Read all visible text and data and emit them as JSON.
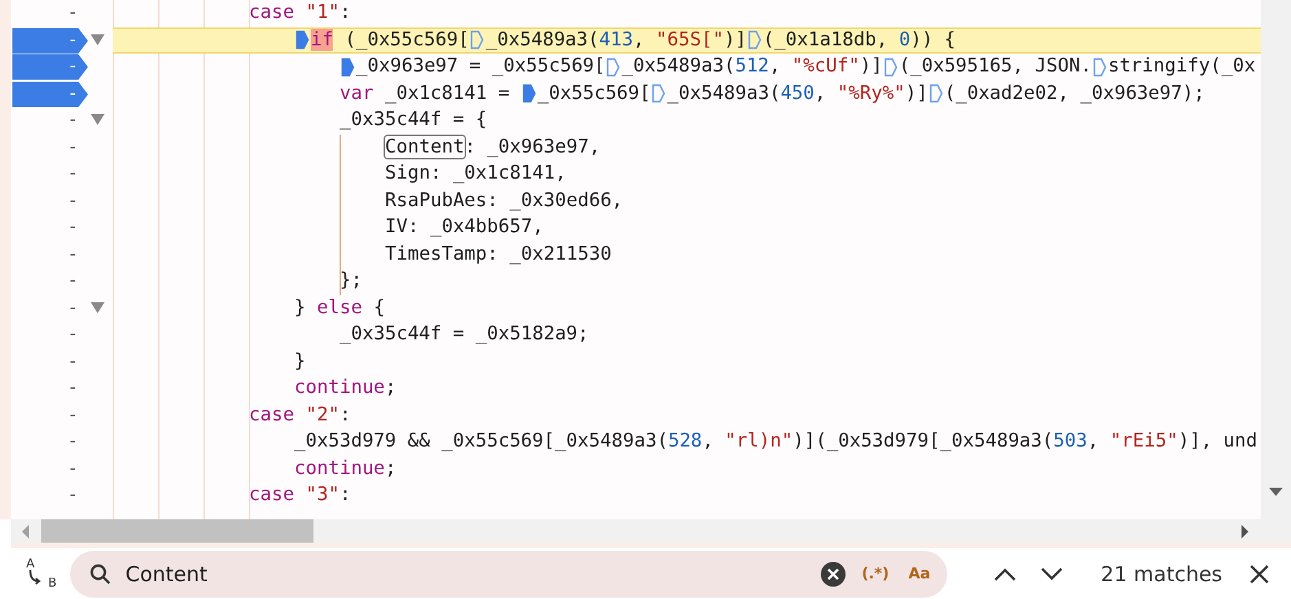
{
  "code_lines": [
    {
      "gutter": "-",
      "breakpoint": false,
      "fold_marker": false,
      "current": false,
      "tokens": [
        {
          "kind": "k",
          "text": "case"
        },
        {
          "kind": "s",
          "text": " \"1\""
        },
        {
          "kind": "t",
          "text": ":"
        }
      ],
      "children": [
        {
          "gutter": "-",
          "breakpoint": true,
          "fold_marker": true,
          "current": true,
          "tokens": [
            {
              "kind": "bp",
              "active": true
            },
            {
              "kind": "paused",
              "text": "if"
            },
            {
              "kind": "t",
              "text": " (_0x55c569["
            },
            {
              "kind": "bp",
              "active": false
            },
            {
              "kind": "t",
              "text": "_0x5489a3("
            },
            {
              "kind": "n",
              "text": "413"
            },
            {
              "kind": "t",
              "text": ", "
            },
            {
              "kind": "s",
              "text": "\"65S[\""
            },
            {
              "kind": "t",
              "text": ")]"
            },
            {
              "kind": "bp",
              "active": false
            },
            {
              "kind": "t",
              "text": "(_0x1a18db, "
            },
            {
              "kind": "n",
              "text": "0"
            },
            {
              "kind": "t",
              "text": ")) {"
            }
          ],
          "children": [
            {
              "gutter": "-",
              "breakpoint": true,
              "fold_marker": false,
              "current": false,
              "tokens": [
                {
                  "kind": "bp",
                  "active": true
                },
                {
                  "kind": "t",
                  "text": "_0x963e97 = _0x55c569["
                },
                {
                  "kind": "bp",
                  "active": false
                },
                {
                  "kind": "t",
                  "text": "_0x5489a3("
                },
                {
                  "kind": "n",
                  "text": "512"
                },
                {
                  "kind": "t",
                  "text": ", "
                },
                {
                  "kind": "s",
                  "text": "\"%cUf\""
                },
                {
                  "kind": "t",
                  "text": ")]"
                },
                {
                  "kind": "bp",
                  "active": false
                },
                {
                  "kind": "t",
                  "text": "(_0x595165, JSON."
                },
                {
                  "kind": "bp",
                  "active": false
                },
                {
                  "kind": "t",
                  "text": "stringify(_0x"
                }
              ]
            },
            {
              "gutter": "-",
              "breakpoint": true,
              "fold_marker": false,
              "current": false,
              "tokens": [
                {
                  "kind": "k",
                  "text": "var"
                },
                {
                  "kind": "t",
                  "text": " _0x1c8141 = "
                },
                {
                  "kind": "bp",
                  "active": true
                },
                {
                  "kind": "t",
                  "text": "_0x55c569["
                },
                {
                  "kind": "bp",
                  "active": false
                },
                {
                  "kind": "t",
                  "text": "_0x5489a3("
                },
                {
                  "kind": "n",
                  "text": "450"
                },
                {
                  "kind": "t",
                  "text": ", "
                },
                {
                  "kind": "s",
                  "text": "\"%Ry%\""
                },
                {
                  "kind": "t",
                  "text": ")]"
                },
                {
                  "kind": "bp",
                  "active": false
                },
                {
                  "kind": "t",
                  "text": "(_0xad2e02, _0x963e97);"
                }
              ]
            },
            {
              "gutter": "-",
              "breakpoint": false,
              "fold_marker": true,
              "current": false,
              "tokens": [
                {
                  "kind": "t",
                  "text": "_0x35c44f = {"
                }
              ],
              "children": [
                {
                  "gutter": "-",
                  "breakpoint": false,
                  "fold_marker": false,
                  "current": false,
                  "tokens": [
                    {
                      "kind": "match",
                      "text": "Content"
                    },
                    {
                      "kind": "t",
                      "text": ": _0x963e97,"
                    }
                  ]
                },
                {
                  "gutter": "-",
                  "breakpoint": false,
                  "fold_marker": false,
                  "current": false,
                  "tokens": [
                    {
                      "kind": "t",
                      "text": "Sign: _0x1c8141,"
                    }
                  ]
                },
                {
                  "gutter": "-",
                  "breakpoint": false,
                  "fold_marker": false,
                  "current": false,
                  "tokens": [
                    {
                      "kind": "t",
                      "text": "RsaPubAes: _0x30ed66,"
                    }
                  ]
                },
                {
                  "gutter": "-",
                  "breakpoint": false,
                  "fold_marker": false,
                  "current": false,
                  "tokens": [
                    {
                      "kind": "t",
                      "text": "IV: _0x4bb657,"
                    }
                  ]
                },
                {
                  "gutter": "-",
                  "breakpoint": false,
                  "fold_marker": false,
                  "current": false,
                  "tokens": [
                    {
                      "kind": "t",
                      "text": "TimesTamp: _0x211530"
                    }
                  ]
                }
              ]
            },
            {
              "gutter": "-",
              "breakpoint": false,
              "fold_marker": false,
              "current": false,
              "tokens": [
                {
                  "kind": "t",
                  "text": "};"
                }
              ]
            }
          ]
        },
        {
          "gutter": "-",
          "breakpoint": false,
          "fold_marker": true,
          "current": false,
          "tokens": [
            {
              "kind": "t",
              "text": "} "
            },
            {
              "kind": "k",
              "text": "else"
            },
            {
              "kind": "t",
              "text": " {"
            }
          ],
          "children": [
            {
              "gutter": "-",
              "breakpoint": false,
              "fold_marker": false,
              "current": false,
              "tokens": [
                {
                  "kind": "t",
                  "text": "_0x35c44f = _0x5182a9;"
                }
              ]
            }
          ]
        },
        {
          "gutter": "-",
          "breakpoint": false,
          "fold_marker": false,
          "current": false,
          "tokens": [
            {
              "kind": "t",
              "text": "}"
            }
          ]
        },
        {
          "gutter": "-",
          "breakpoint": false,
          "fold_marker": false,
          "current": false,
          "tokens": [
            {
              "kind": "k",
              "text": "continue"
            },
            {
              "kind": "t",
              "text": ";"
            }
          ]
        }
      ]
    },
    {
      "gutter": "-",
      "breakpoint": false,
      "fold_marker": false,
      "current": false,
      "tokens": [
        {
          "kind": "k",
          "text": "case"
        },
        {
          "kind": "s",
          "text": " \"2\""
        },
        {
          "kind": "t",
          "text": ":"
        }
      ],
      "children": [
        {
          "gutter": "-",
          "breakpoint": false,
          "fold_marker": false,
          "current": false,
          "tokens": [
            {
              "kind": "t",
              "text": "_0x53d979 && _0x55c569[_0x5489a3("
            },
            {
              "kind": "n",
              "text": "528"
            },
            {
              "kind": "t",
              "text": ", "
            },
            {
              "kind": "s",
              "text": "\"rl)n\""
            },
            {
              "kind": "t",
              "text": ")](_0x53d979[_0x5489a3("
            },
            {
              "kind": "n",
              "text": "503"
            },
            {
              "kind": "t",
              "text": ", "
            },
            {
              "kind": "s",
              "text": "\"rEi5\""
            },
            {
              "kind": "t",
              "text": ")], und"
            }
          ]
        },
        {
          "gutter": "-",
          "breakpoint": false,
          "fold_marker": false,
          "current": false,
          "tokens": [
            {
              "kind": "k",
              "text": "continue"
            },
            {
              "kind": "t",
              "text": ";"
            }
          ]
        }
      ]
    },
    {
      "gutter": "-",
      "breakpoint": false,
      "fold_marker": false,
      "current": false,
      "tokens": [
        {
          "kind": "k",
          "text": "case"
        },
        {
          "kind": "s",
          "text": " \"3\""
        },
        {
          "kind": "t",
          "text": ":"
        }
      ]
    }
  ],
  "search": {
    "replace_toggle": {
      "top": "A",
      "bottom": "B"
    },
    "value": "Content",
    "regex_label": "(.*)",
    "case_label": "Aa",
    "match_count": "21 matches"
  }
}
